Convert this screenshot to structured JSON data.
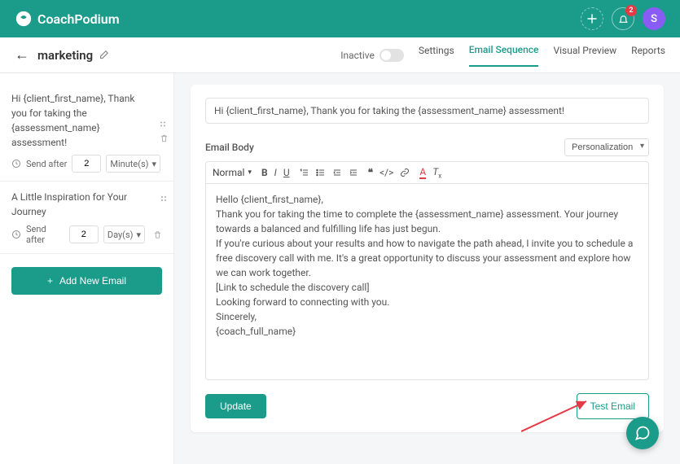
{
  "brand": "CoachPodium",
  "notifications": {
    "count": "2"
  },
  "avatar": {
    "initial": "S"
  },
  "page": {
    "title": "marketing"
  },
  "status": {
    "label": "Inactive"
  },
  "tabs": {
    "settings": "Settings",
    "email_sequence": "Email Sequence",
    "visual_preview": "Visual Preview",
    "reports": "Reports"
  },
  "send_after_label": "Send after",
  "sidebar": {
    "items": [
      {
        "subject": "Hi {client_first_name}, Thank you for taking the {assessment_name} assessment!",
        "send_value": "2",
        "send_unit": "Minute(s)"
      },
      {
        "subject": "A Little Inspiration for Your Journey",
        "send_value": "2",
        "send_unit": "Day(s)"
      }
    ],
    "add_label": "Add New Email"
  },
  "editor": {
    "subject": "Hi {client_first_name}, Thank you for taking the {assessment_name} assessment!",
    "body_label": "Email Body",
    "personalization": "Personalization",
    "format": "Normal",
    "body": "Hello {client_first_name},\nThank you for taking the time to complete the {assessment_name} assessment. Your journey towards a balanced and fulfilling life has just begun.\nIf you're curious about your results and how to navigate the path ahead, I invite you to schedule a free discovery call with me. It's a great opportunity to discuss your assessment and explore how we can work together.\n[Link to schedule the discovery call]\nLooking forward to connecting with you.\nSincerely,\n{coach_full_name}"
  },
  "buttons": {
    "update": "Update",
    "test_email": "Test Email"
  }
}
